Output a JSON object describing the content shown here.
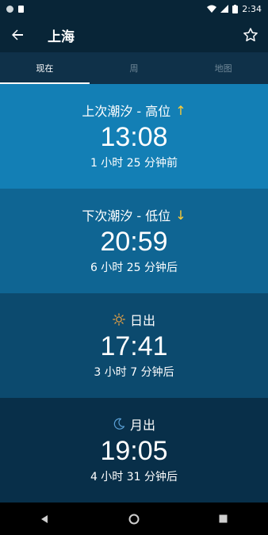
{
  "status_bar": {
    "time": "2:34"
  },
  "app_bar": {
    "title": "上海"
  },
  "tabs": [
    {
      "label": "现在",
      "active": true
    },
    {
      "label": "周",
      "active": false
    },
    {
      "label": "地图",
      "active": false
    }
  ],
  "cards": {
    "last_tide": {
      "label": "上次潮汐 - 高位",
      "arrow": "↑",
      "time": "13:08",
      "relative": "1 小时 25 分钟前"
    },
    "next_tide": {
      "label": "下次潮汐 - 低位",
      "arrow": "↓",
      "time": "20:59",
      "relative": "6 小时 25 分钟后"
    },
    "sunrise": {
      "label": "日出",
      "time": "17:41",
      "relative": "3 小时 7 分钟后"
    },
    "moonrise": {
      "label": "月出",
      "time": "19:05",
      "relative": "4 小时 31 分钟后"
    }
  },
  "icons": {
    "back": "arrow-back-icon",
    "favorite": "star-outline-icon",
    "sun": "sun-icon",
    "moon": "moon-icon"
  },
  "colors": {
    "tide_arrow": "#ffcc33",
    "sun_icon": "#f2a541",
    "moon_icon": "#5aa0d6"
  }
}
